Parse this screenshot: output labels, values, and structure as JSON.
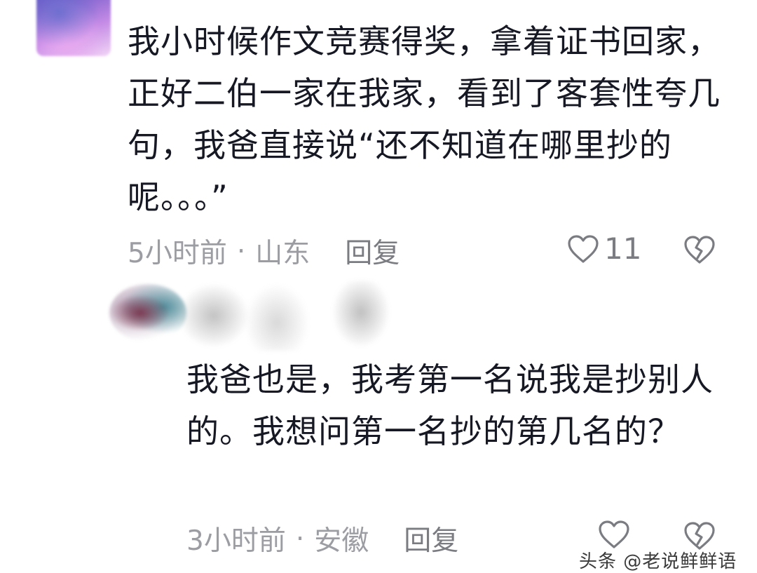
{
  "comments": [
    {
      "text": "我小时候作文竞赛得奖，拿着证书回家，正好二伯一家在我家，看到了客套性夸几句，我爸直接说“还不知道在哪里抄的呢。。。”",
      "time": "5小时前",
      "separator": "·",
      "location": "山东",
      "reply_label": "回复",
      "like_count": "11",
      "like_icon": "heart-outline-icon",
      "dislike_icon": "broken-heart-icon"
    },
    {
      "text": "我爸也是，我考第一名说我是抄别人的。我想问第一名抄的第几名的？",
      "time": "3小时前",
      "separator": "·",
      "location": "安徽",
      "reply_label": "回复",
      "like_icon": "heart-outline-icon",
      "dislike_icon": "broken-heart-icon"
    }
  ],
  "watermark": "头条 @老说鲜鲜语",
  "colors": {
    "text": "#161823",
    "meta": "#9c9da3",
    "icon": "#7b7c82",
    "background": "#ffffff"
  }
}
